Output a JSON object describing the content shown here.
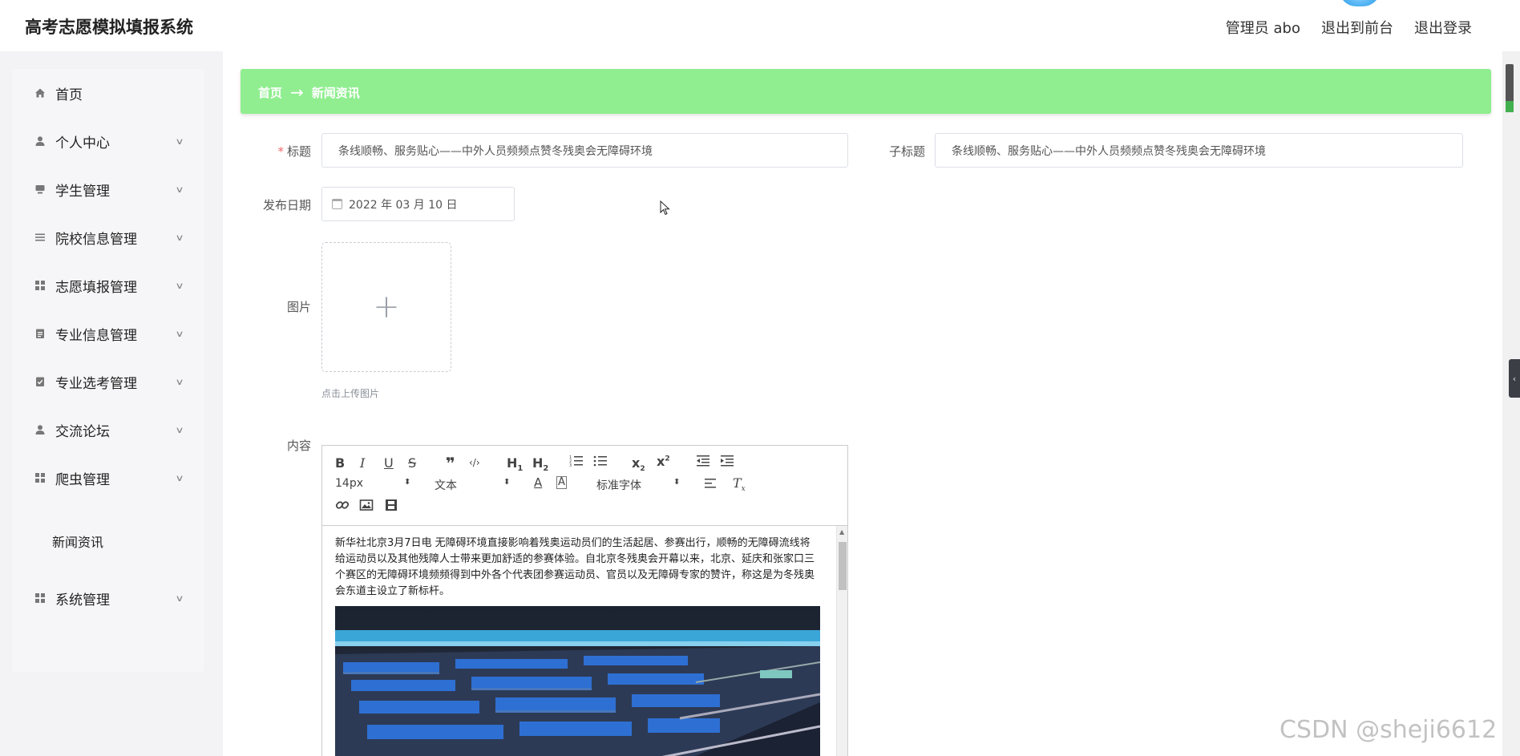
{
  "app": {
    "title": "高考志愿模拟填报系统"
  },
  "header": {
    "user": "管理员 abo",
    "to_frontend": "退出到前台",
    "logout": "退出登录"
  },
  "sidebar": {
    "items": [
      {
        "label": "首页",
        "icon": "home-icon",
        "chevron": false
      },
      {
        "label": "个人中心",
        "icon": "user-icon",
        "chevron": true
      },
      {
        "label": "学生管理",
        "icon": "student-icon",
        "chevron": true
      },
      {
        "label": "院校信息管理",
        "icon": "list-icon",
        "chevron": true
      },
      {
        "label": "志愿填报管理",
        "icon": "grid-icon",
        "chevron": true
      },
      {
        "label": "专业信息管理",
        "icon": "clipboard-icon",
        "chevron": true
      },
      {
        "label": "专业选考管理",
        "icon": "clipboard-check-icon",
        "chevron": true
      },
      {
        "label": "交流论坛",
        "icon": "user-icon",
        "chevron": true
      },
      {
        "label": "爬虫管理",
        "icon": "grid-icon",
        "chevron": true
      },
      {
        "label": "系统管理",
        "icon": "grid-icon",
        "chevron": true
      }
    ],
    "subitem": "新闻资讯"
  },
  "breadcrumb": {
    "home": "首页",
    "arrow": "→",
    "current": "新闻资讯"
  },
  "form": {
    "title_label": "标题",
    "title_value": "条线顺畅、服务贴心——中外人员频频点赞冬残奥会无障碍环境",
    "subtitle_label": "子标题",
    "subtitle_value": "条线顺畅、服务贴心——中外人员频频点赞冬残奥会无障碍环境",
    "date_label": "发布日期",
    "date_value": "2022 年 03 月 10 日",
    "image_label": "图片",
    "upload_hint": "点击上传图片",
    "content_label": "内容"
  },
  "editor": {
    "font_size": "14px",
    "paragraph": "文本",
    "font_family": "标准字体",
    "content": "新华社北京3月7日电 无障碍环境直接影响着残奥运动员们的生活起居、参赛出行，顺畅的无障碍流线将给运动员以及其他残障人士带来更加舒适的参赛体验。自北京冬残奥会开幕以来，北京、延庆和张家口三个赛区的无障碍环境频频得到中外各个代表团参赛运动员、官员以及无障碍专家的赞许，称这是为冬残奥会东道主设立了新标杆。"
  },
  "watermark": "CSDN @sheji6612"
}
